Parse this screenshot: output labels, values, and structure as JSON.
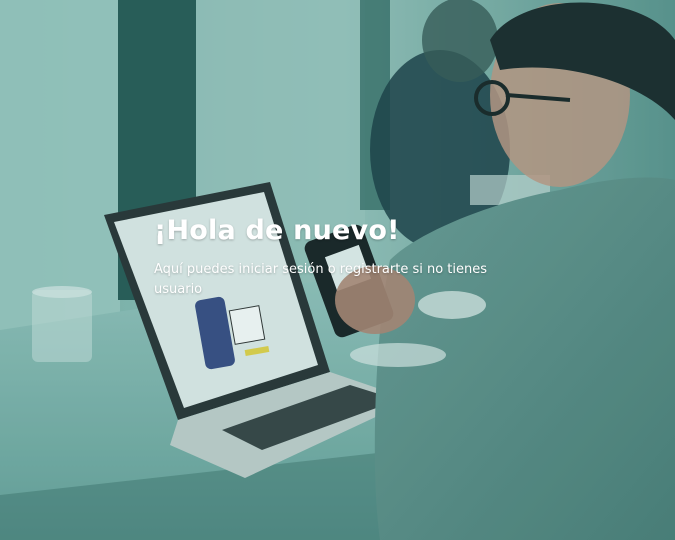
{
  "hero": {
    "title": "¡Hola de nuevo!",
    "subtitle": "Aquí puedes iniciar sesión o registrarte si no tienes usuario"
  },
  "theme": {
    "overlay_color": "#2a7a72",
    "text_color": "#ffffff"
  },
  "background": {
    "description_icon": "person-using-phone-photo"
  }
}
